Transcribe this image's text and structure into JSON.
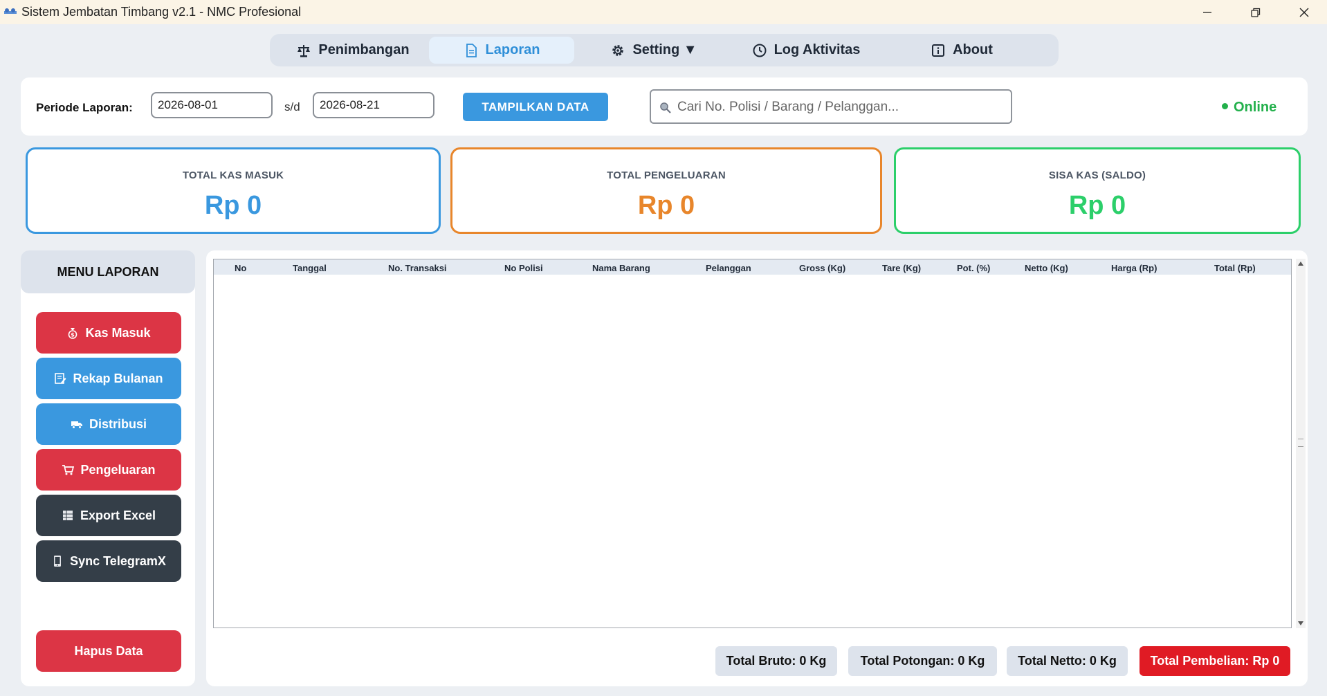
{
  "window": {
    "title": "Sistem Jembatan Timbang v2.1 - NMC Profesional",
    "controls": [
      "minimize",
      "restore",
      "close"
    ]
  },
  "nav": {
    "tabs": [
      {
        "label": "Penimbangan",
        "icon": "scale-icon",
        "active": false
      },
      {
        "label": "Laporan",
        "icon": "document-icon",
        "active": true
      },
      {
        "label": "Setting ▼",
        "icon": "gear-icon",
        "active": false
      },
      {
        "label": "Log Aktivitas",
        "icon": "clock-icon",
        "active": false
      },
      {
        "label": "About",
        "icon": "info-icon",
        "active": false
      }
    ]
  },
  "filter": {
    "periode_label": "Periode Laporan:",
    "date_from": "2026-08-01",
    "separator": "s/d",
    "date_to": "2026-08-21",
    "show_button": "TAMPILKAN DATA",
    "search_placeholder": "Cari No. Polisi / Barang / Pelanggan...",
    "status": "Online"
  },
  "summary": {
    "kas_masuk": {
      "label": "TOTAL KAS MASUK",
      "value": "Rp 0"
    },
    "pengeluaran": {
      "label": "TOTAL PENGELUARAN",
      "value": "Rp 0"
    },
    "saldo": {
      "label": "SISA KAS (SALDO)",
      "value": "Rp 0"
    }
  },
  "sidebar": {
    "title": "MENU LAPORAN",
    "items": [
      {
        "label": "Kas Masuk",
        "icon": "money-bag-icon",
        "color": "#dc3545"
      },
      {
        "label": "Rekap Bulanan",
        "icon": "memo-icon",
        "color": "#3a98df"
      },
      {
        "label": "Distribusi",
        "icon": "truck-icon",
        "color": "#3a98df"
      },
      {
        "label": "Pengeluaran",
        "icon": "cart-icon",
        "color": "#dc3545"
      },
      {
        "label": "Export Excel",
        "icon": "spreadsheet-icon",
        "color": "#343e48"
      },
      {
        "label": "Sync TelegramX",
        "icon": "phone-icon",
        "color": "#343e48"
      }
    ],
    "delete_button": "Hapus Data"
  },
  "table": {
    "columns": [
      "No",
      "Tanggal",
      "No. Transaksi",
      "No Polisi",
      "Nama Barang",
      "Pelanggan",
      "Gross (Kg)",
      "Tare (Kg)",
      "Pot. (%)",
      "Netto (Kg)",
      "Harga (Rp)",
      "Total (Rp)"
    ],
    "rows": []
  },
  "totals": {
    "bruto": "Total Bruto: 0 Kg",
    "potongan": "Total Potongan: 0 Kg",
    "netto": "Total Netto: 0 Kg",
    "pembelian": "Total Pembelian: Rp 0"
  },
  "colors": {
    "accent_blue": "#3a98df",
    "accent_orange": "#e8862b",
    "accent_green": "#2ccf6a",
    "danger_red": "#dc3545",
    "dark": "#343e48"
  }
}
